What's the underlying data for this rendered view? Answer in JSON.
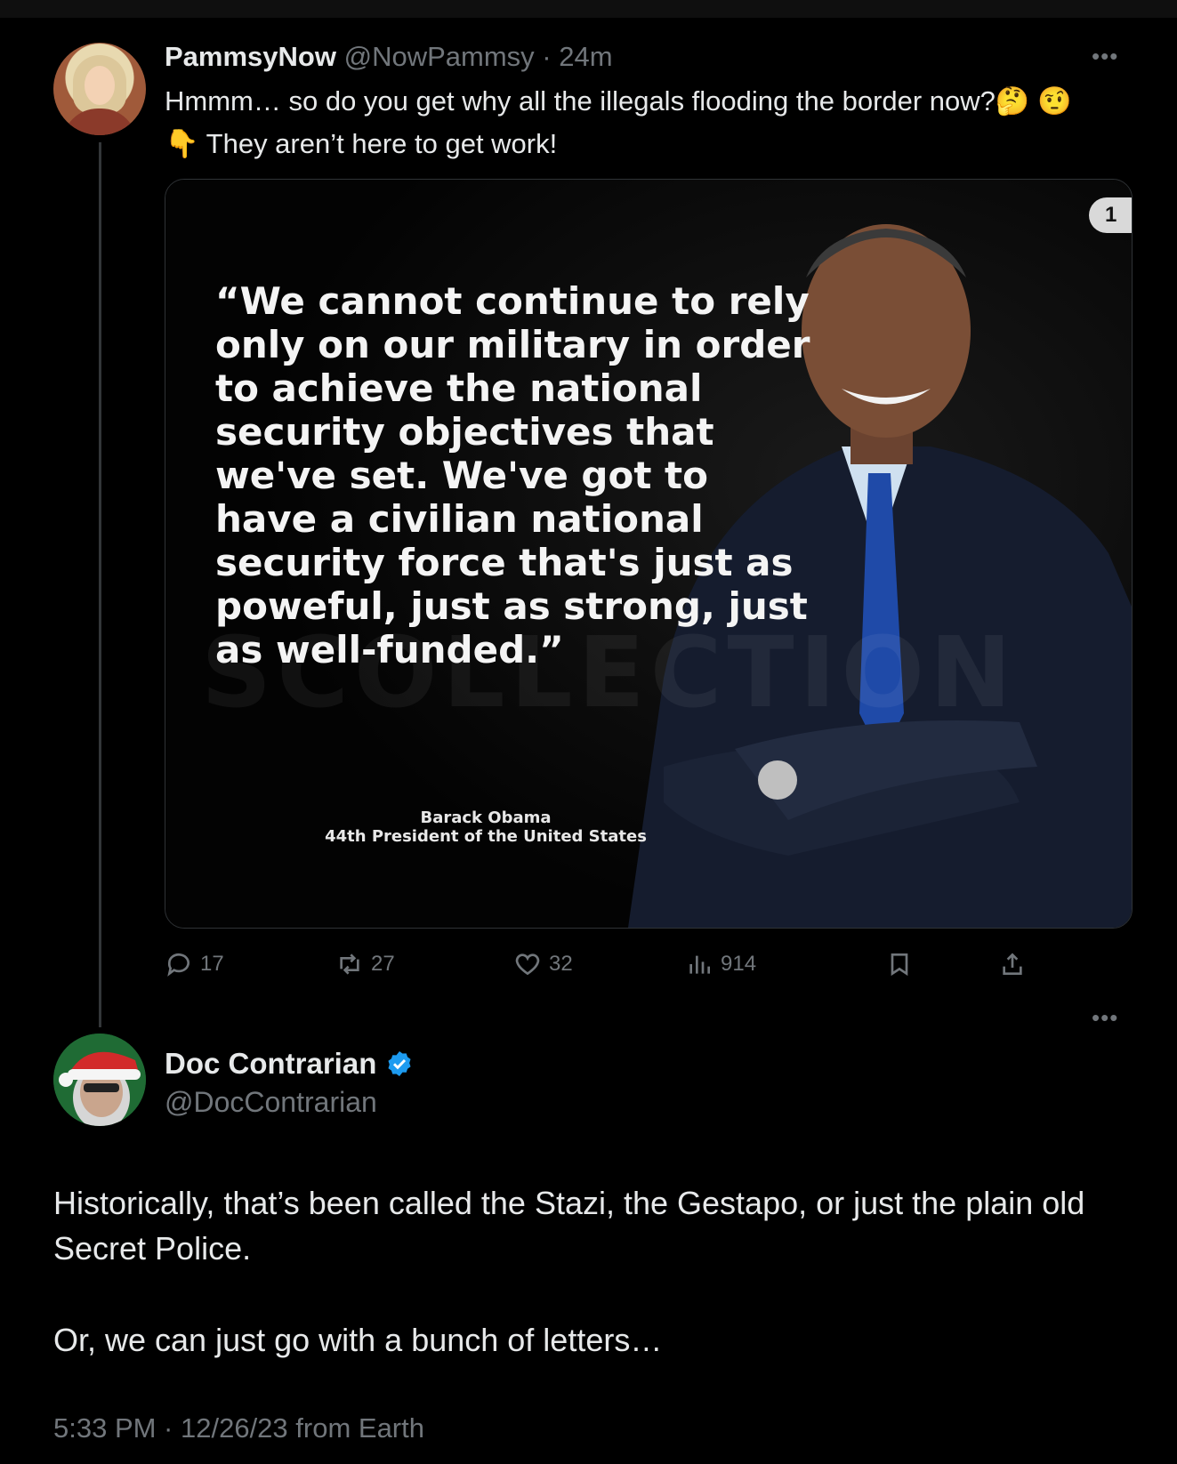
{
  "tweet1": {
    "display_name": "PammsyNow",
    "handle": "@NowPammsy",
    "separator": "·",
    "time": "24m",
    "text": "Hmmm… so do you get why all the illegals flooding the border now?🤔 🤨 👇 They aren’t here to get work!",
    "media": {
      "quote": "“We cannot continue to rely only on our military in order to achieve the national security objectives that we've set. We've got to have a civilian national security force that's just as poweful, just as strong, just as well-funded.”",
      "attribution_name": "Barack Obama",
      "attribution_title": "44th President of the United States",
      "watermark": "SCOLLECTION",
      "badge": "1"
    },
    "stats": {
      "replies": "17",
      "reposts": "27",
      "likes": "32",
      "views": "914"
    }
  },
  "tweet2": {
    "display_name": "Doc Contrarian",
    "handle": "@DocContrarian",
    "verified": true,
    "paragraph1": "Historically, that’s been called the Stazi, the Gestapo, or just the plain old Secret Police.",
    "paragraph2": "Or, we can just go with a bunch of letters…",
    "meta": "5:33 PM · 12/26/23 from Earth"
  },
  "colors": {
    "background": "#000000",
    "text": "#e7e9ea",
    "muted": "#71767b",
    "verified_blue": "#1d9bf0",
    "border": "#2f3336"
  },
  "icons": [
    "more-icon",
    "reply-icon",
    "repost-icon",
    "like-icon",
    "views-icon",
    "bookmark-icon",
    "share-icon",
    "verified-badge-icon"
  ]
}
